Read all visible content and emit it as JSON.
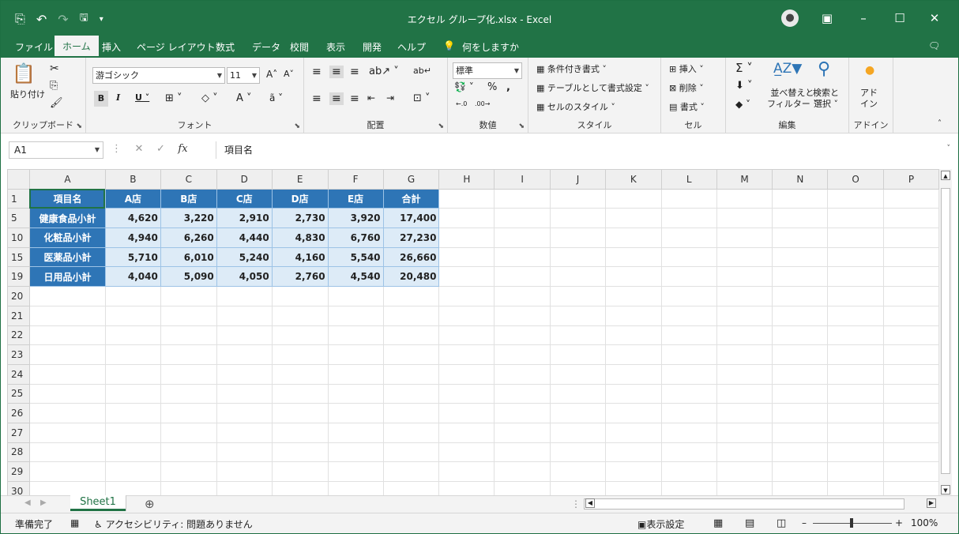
{
  "window": {
    "title": "エクセル グループ化.xlsx  -  Excel"
  },
  "menu": {
    "file": "ファイル",
    "home": "ホーム",
    "insert": "挿入",
    "page_layout": "ページ レイアウト",
    "formulas": "数式",
    "data": "データ",
    "review": "校閲",
    "view": "表示",
    "developer": "開発",
    "help": "ヘルプ",
    "tell_me": "何をしますか"
  },
  "ribbon": {
    "clipboard": {
      "paste": "貼り付け",
      "label": "クリップボード"
    },
    "font": {
      "name": "游ゴシック",
      "size": "11",
      "label": "フォント"
    },
    "alignment": {
      "label": "配置"
    },
    "number": {
      "format": "標準",
      "label": "数値"
    },
    "styles": {
      "conditional": "条件付き書式",
      "as_table": "テーブルとして書式設定",
      "cell_styles": "セルのスタイル",
      "label": "スタイル"
    },
    "cells": {
      "insert": "挿入",
      "delete": "削除",
      "format": "書式",
      "label": "セル"
    },
    "editing": {
      "sort": "並べ替えと",
      "sort2": "フィルター",
      "find": "検索と",
      "find2": "選択",
      "label": "編集"
    },
    "addins": {
      "name1": "アド",
      "name2": "イン",
      "label": "アドイン"
    }
  },
  "formula_bar": {
    "name_box": "A1",
    "content": "項目名"
  },
  "sheet": {
    "columns": [
      "A",
      "B",
      "C",
      "D",
      "E",
      "F",
      "G",
      "H",
      "I",
      "J",
      "K",
      "L",
      "M",
      "N",
      "O",
      "P"
    ],
    "header_row": {
      "row": "1",
      "cells": [
        "項目名",
        "A店",
        "B店",
        "C店",
        "D店",
        "E店",
        "合計"
      ]
    },
    "data_rows": [
      {
        "row": "5",
        "cells": [
          "健康食品小計",
          "4,620",
          "3,220",
          "2,910",
          "2,730",
          "3,920",
          "17,400"
        ]
      },
      {
        "row": "10",
        "cells": [
          "化粧品小計",
          "4,940",
          "6,260",
          "4,440",
          "4,830",
          "6,760",
          "27,230"
        ]
      },
      {
        "row": "15",
        "cells": [
          "医薬品小計",
          "5,710",
          "6,010",
          "5,240",
          "4,160",
          "5,540",
          "26,660"
        ]
      },
      {
        "row": "19",
        "cells": [
          "日用品小計",
          "4,040",
          "5,090",
          "4,050",
          "2,760",
          "4,540",
          "20,480"
        ]
      }
    ],
    "empty_rows": [
      "20",
      "21",
      "22",
      "23",
      "24",
      "25",
      "26",
      "27",
      "28",
      "29",
      "30"
    ]
  },
  "tabs": {
    "sheet1": "Sheet1"
  },
  "status": {
    "ready": "準備完了",
    "accessibility": "アクセシビリティ: 問題ありません",
    "display_settings": "表示設定",
    "zoom": "100%"
  },
  "colors": {
    "excel_green": "#217346",
    "header_blue": "#2e75b6",
    "data_fill": "#ddebf7"
  }
}
